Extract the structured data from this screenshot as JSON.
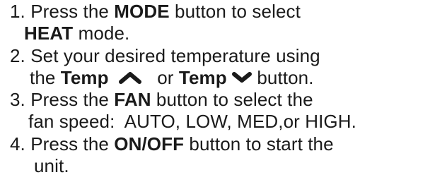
{
  "steps": [
    {
      "number": "1.",
      "pre": "Press the",
      "bold": "MODE",
      "post": "button to select",
      "line2_bold": "HEAT",
      "line2_post": "mode."
    },
    {
      "number": "2.",
      "text": "Set your desired temperature using",
      "line2_pre": "the",
      "temp_up_label": "Temp",
      "or_word": "or",
      "temp_down_label": "Temp",
      "line2_post": "button.",
      "up_icon": "chevron-up-icon",
      "down_icon": "chevron-down-icon"
    },
    {
      "number": "3.",
      "pre": "Press the",
      "bold": "FAN",
      "post": "button to select the",
      "line2": "fan speed:  AUTO, LOW, MED,or HIGH."
    },
    {
      "number": "4.",
      "pre": "Press the",
      "bold": "ON/OFF",
      "post": "button to start the",
      "line2": "unit."
    }
  ],
  "colors": {
    "text": "#1a1a1a",
    "background": "#ffffff"
  }
}
